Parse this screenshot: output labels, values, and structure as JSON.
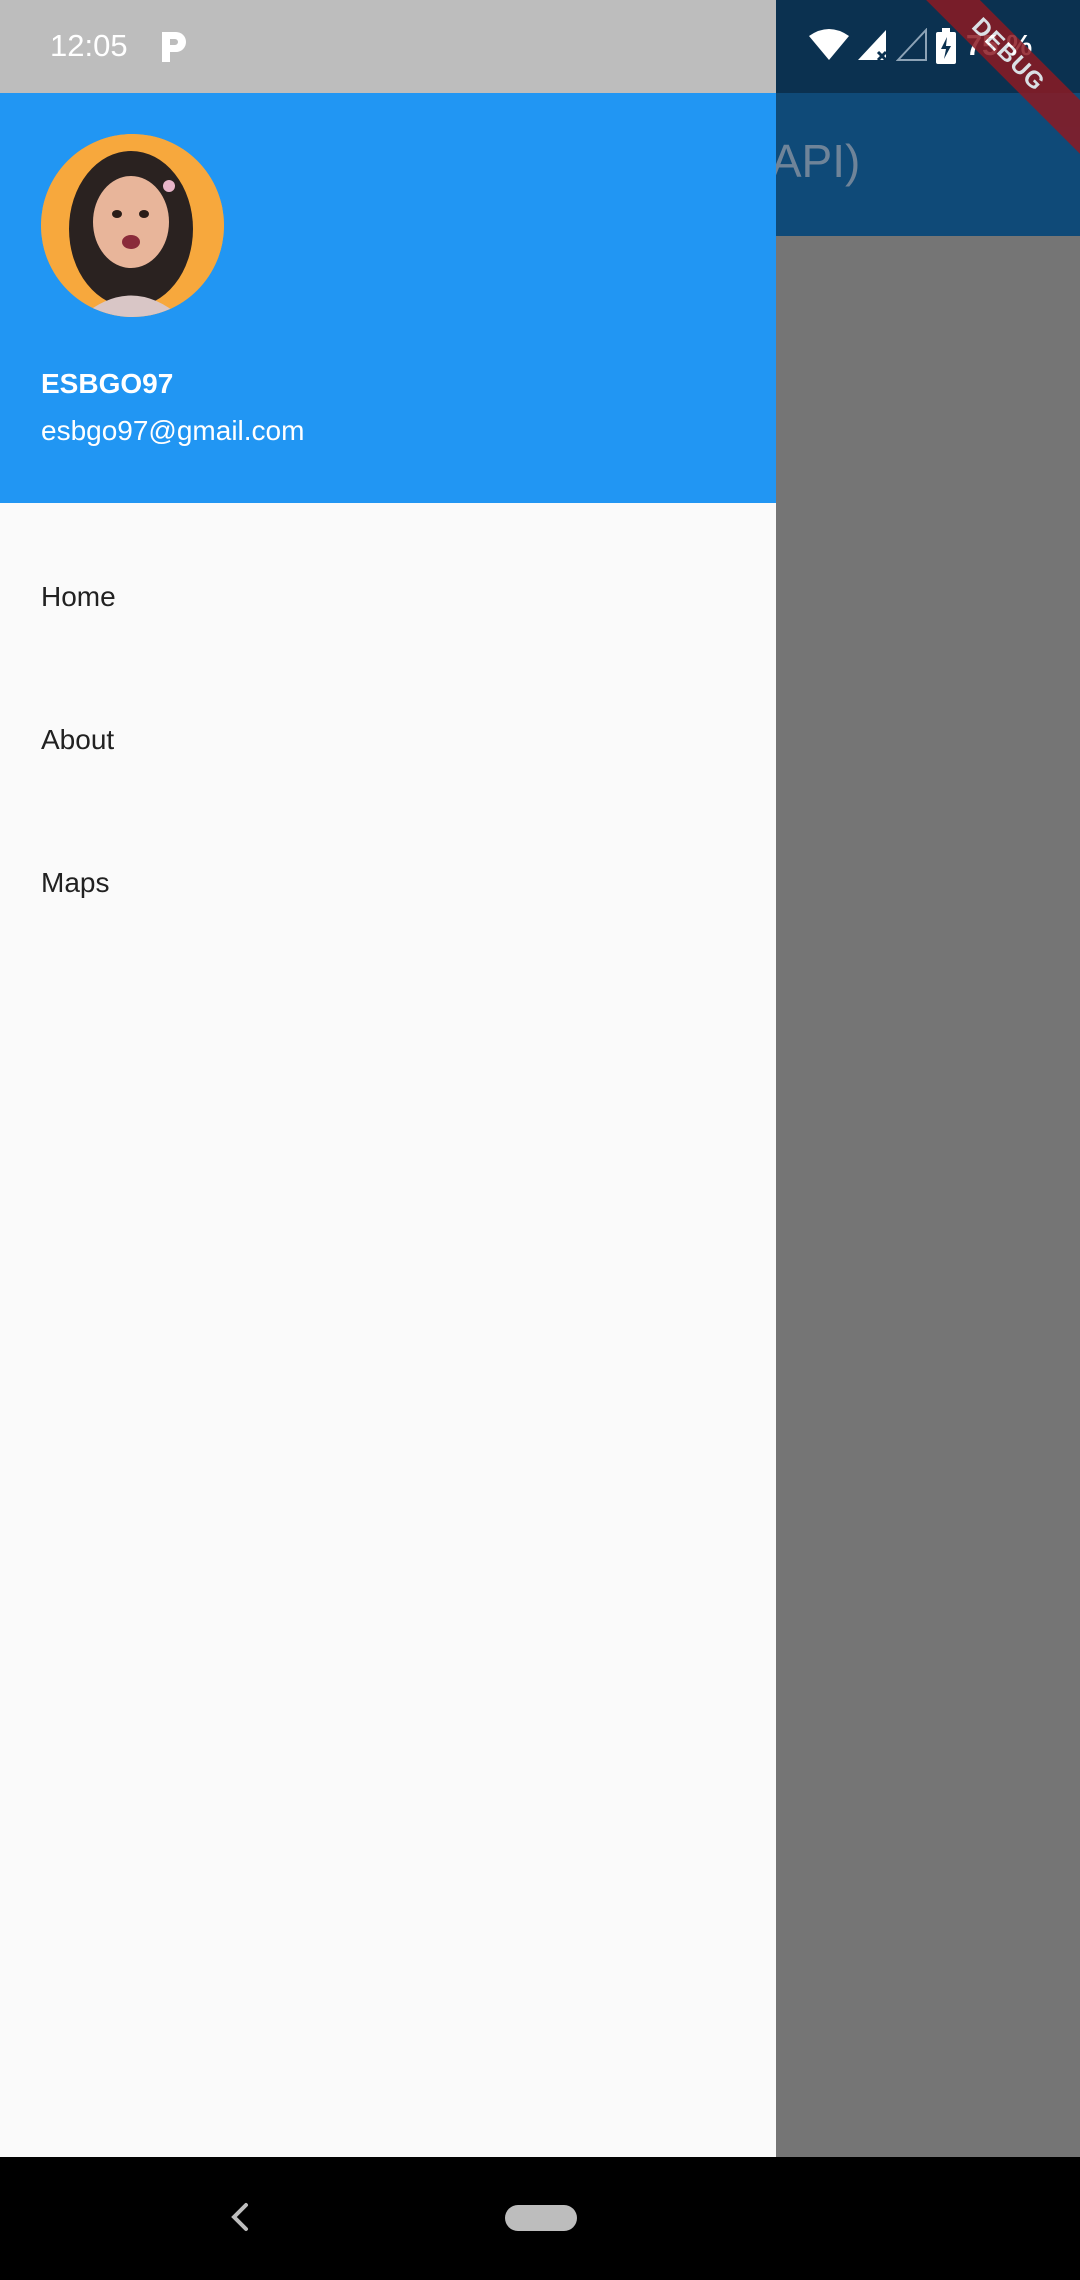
{
  "status_bar": {
    "time": "12:05",
    "battery": "75 %",
    "icons": [
      "p-app-icon",
      "wifi-icon",
      "signal-icon",
      "no-signal-icon",
      "battery-charging-icon"
    ]
  },
  "debug_banner": "DEBUG",
  "app_bar": {
    "title_visible": "o API)"
  },
  "drawer": {
    "header": {
      "account_name": "ESBGO97",
      "account_email": "esbgo97@gmail.com",
      "header_color": "#2196f3"
    },
    "menu_items": [
      {
        "label": "Home"
      },
      {
        "label": "About"
      },
      {
        "label": "Maps"
      }
    ]
  },
  "nav_bar": {
    "icons": [
      "back-icon",
      "home-pill"
    ]
  }
}
